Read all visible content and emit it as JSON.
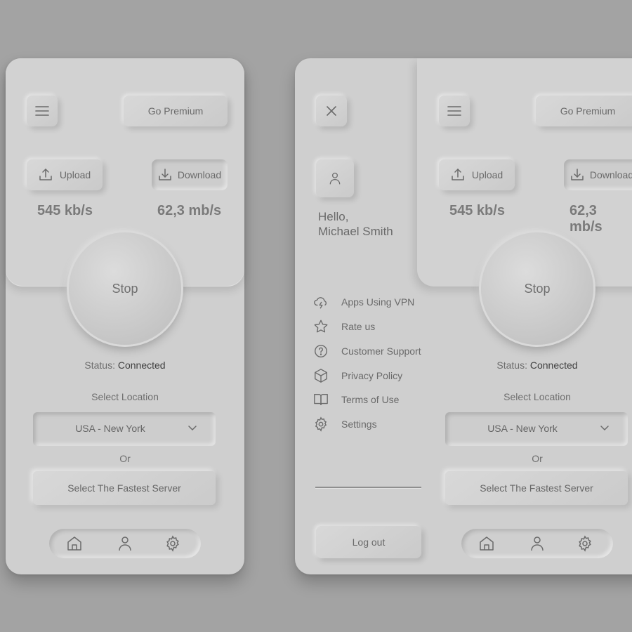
{
  "app": {
    "menu_icon": "hamburger-icon",
    "premium_label": "Go Premium",
    "upload_label": "Upload",
    "download_label": "Download",
    "upload_speed": "545 kb/s",
    "download_speed": "62,3 mb/s",
    "stop_label": "Stop",
    "status_label": "Status:",
    "status_value": "Connected",
    "select_location_label": "Select Location",
    "location_value": "USA - New York",
    "or_label": "Or",
    "fastest_server_label": "Select The Fastest Server"
  },
  "drawer": {
    "close_icon": "close-icon",
    "avatar_icon": "user-icon",
    "greeting_line1": "Hello,",
    "greeting_line2": "Michael Smith",
    "items": [
      {
        "label": "Apps Using VPN",
        "icon": "cloud-lightning-icon"
      },
      {
        "label": "Rate us",
        "icon": "star-icon"
      },
      {
        "label": "Customer Support",
        "icon": "help-circle-icon"
      },
      {
        "label": "Privacy Policy",
        "icon": "box-icon"
      },
      {
        "label": "Terms of Use",
        "icon": "book-icon"
      },
      {
        "label": "Settings",
        "icon": "gear-icon"
      }
    ],
    "logout_label": "Log out"
  },
  "bottom_nav": [
    "home-icon",
    "user-icon",
    "gear-icon"
  ],
  "colors": {
    "background": "#a3a3a3",
    "surface": "#cfcfcf",
    "text": "#6a6a6a",
    "status_value": "#3f3f3f"
  }
}
